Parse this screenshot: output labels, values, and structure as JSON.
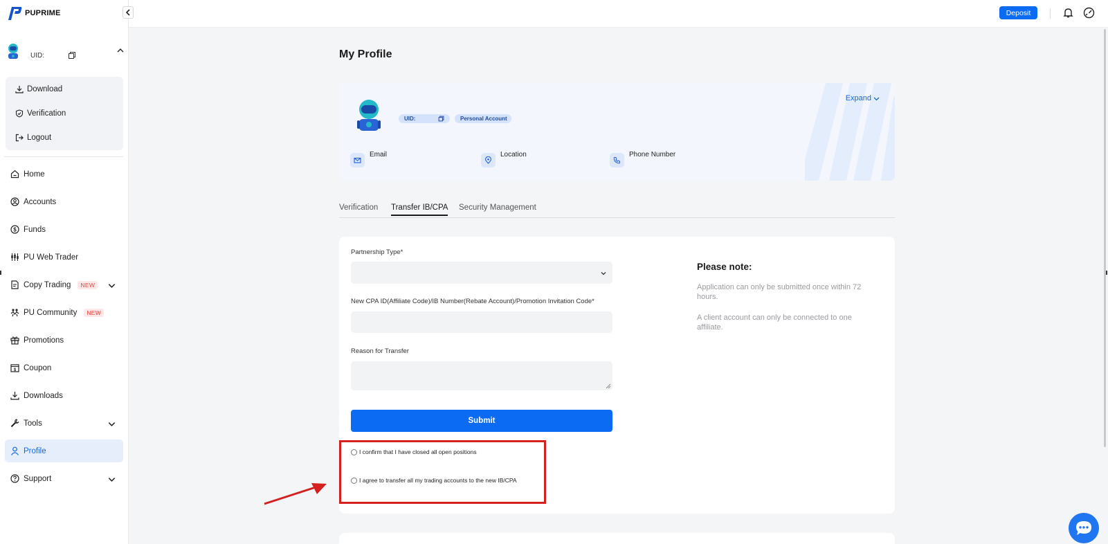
{
  "brand": {
    "name": "PUPRIME"
  },
  "user": {
    "uid_label": "UID:"
  },
  "user_menu": [
    {
      "label": "Download",
      "icon": "download-icon"
    },
    {
      "label": "Verification",
      "icon": "shield-check-icon"
    },
    {
      "label": "Logout",
      "icon": "logout-icon"
    }
  ],
  "nav": [
    {
      "label": "Home",
      "icon": "home-icon"
    },
    {
      "label": "Accounts",
      "icon": "user-circle-icon"
    },
    {
      "label": "Funds",
      "icon": "dollar-circle-icon"
    },
    {
      "label": "PU Web Trader",
      "icon": "candlestick-icon"
    },
    {
      "label": "Copy Trading",
      "icon": "document-icon",
      "badge": "NEW",
      "expandable": true
    },
    {
      "label": "PU Community",
      "icon": "community-icon",
      "badge": "NEW"
    },
    {
      "label": "Promotions",
      "icon": "gift-icon"
    },
    {
      "label": "Coupon",
      "icon": "coupon-icon"
    },
    {
      "label": "Downloads",
      "icon": "download-icon"
    },
    {
      "label": "Tools",
      "icon": "wrench-icon",
      "expandable": true
    },
    {
      "label": "Profile",
      "icon": "person-icon",
      "active": true
    },
    {
      "label": "Support",
      "icon": "help-circle-icon",
      "expandable": true
    }
  ],
  "topbar": {
    "deposit_label": "Deposit",
    "icons": [
      "bell-icon",
      "speedometer-icon"
    ]
  },
  "page": {
    "title": "My Profile"
  },
  "profile_card": {
    "uid_label": "UID:",
    "account_type": "Personal Account",
    "expand_label": "Expand",
    "info": [
      {
        "label": "Email",
        "icon": "mail-icon"
      },
      {
        "label": "Location",
        "icon": "location-pin-icon"
      },
      {
        "label": "Phone Number",
        "icon": "phone-icon"
      }
    ]
  },
  "tabs": [
    {
      "label": "Verification",
      "active": false
    },
    {
      "label": "Transfer IB/CPA",
      "active": true
    },
    {
      "label": "Security Management",
      "active": false
    }
  ],
  "form": {
    "partnership_type_label": "Partnership Type*",
    "partnership_type_value": "",
    "code_label": "New CPA ID(Affiliate Code)/IB Number(Rebate Account)/Promotion Invitation Code*",
    "code_value": "",
    "reason_label": "Reason for Transfer",
    "reason_value": "",
    "submit_label": "Submit",
    "confirm_closed_positions": "I confirm that I have closed all open positions",
    "agree_transfer_accounts": "I agree to transfer all my trading accounts to the new IB/CPA"
  },
  "note": {
    "title": "Please note:",
    "lines": [
      "Application can only be submitted once within 72 hours.",
      "A client account can only be connected to one affiliate."
    ]
  },
  "colors": {
    "accent": "#0b6bf2",
    "highlight": "#d4201f",
    "new_badge": "#e4433b"
  }
}
